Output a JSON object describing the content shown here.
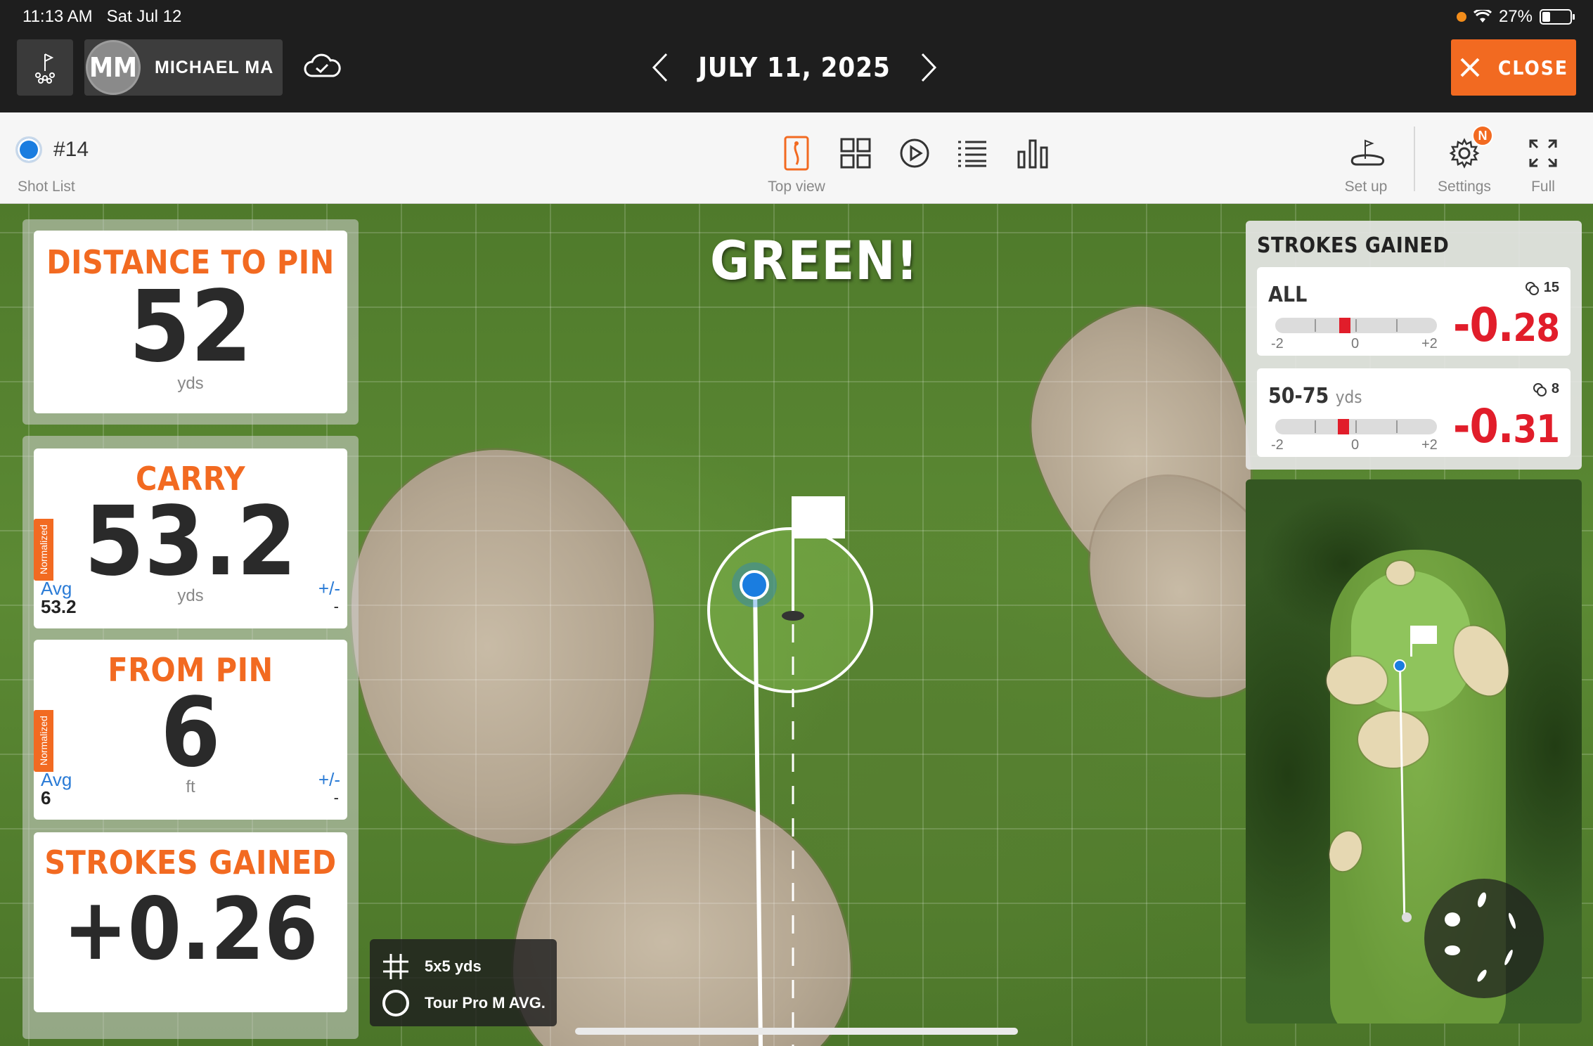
{
  "status_bar": {
    "time": "11:13 AM",
    "date": "Sat Jul 12",
    "battery": "27%"
  },
  "header": {
    "user_initials": "MM",
    "user_name": "MICHAEL MA",
    "date": "JULY 11, 2025",
    "close_label": "CLOSE"
  },
  "toolbar": {
    "shot_number": "#14",
    "shot_list_label": "Shot List",
    "top_view_label": "Top view",
    "setup_label": "Set up",
    "settings_label": "Settings",
    "settings_badge": "N",
    "full_label": "Full"
  },
  "map": {
    "banner": "GREEN!",
    "legend": {
      "grid_label": "5x5 yds",
      "circle_label": "Tour Pro M AVG."
    }
  },
  "stats": {
    "distance_to_pin": {
      "title": "DISTANCE TO PIN",
      "value": "52",
      "unit": "yds"
    },
    "carry": {
      "title": "CARRY",
      "value": "53.2",
      "unit": "yds",
      "tag": "Normalized",
      "avg_label": "Avg",
      "avg_value": "53.2",
      "pm_label": "+/-",
      "pm_value": "-"
    },
    "from_pin": {
      "title": "FROM PIN",
      "value": "6",
      "unit": "ft",
      "tag": "Normalized",
      "avg_label": "Avg",
      "avg_value": "6",
      "pm_label": "+/-",
      "pm_value": "-"
    },
    "strokes_gained": {
      "title": "STROKES GAINED",
      "value": "+0.26"
    }
  },
  "strokes_gained_panel": {
    "title": "STROKES GAINED",
    "rows": [
      {
        "label": "ALL",
        "sub": "",
        "count": "15",
        "value_main": "-0.",
        "value_dec": "28",
        "axis_min": "-2",
        "axis_mid": "0",
        "axis_max": "+2",
        "level": -0.28
      },
      {
        "label": "50-75",
        "sub": "yds",
        "count": "8",
        "value_main": "-0.",
        "value_dec": "31",
        "axis_min": "-2",
        "axis_mid": "0",
        "axis_max": "+2",
        "level": -0.31
      }
    ]
  },
  "colors": {
    "accent": "#f26a21",
    "negative": "#e11d2a",
    "ball": "#1a7de0"
  }
}
